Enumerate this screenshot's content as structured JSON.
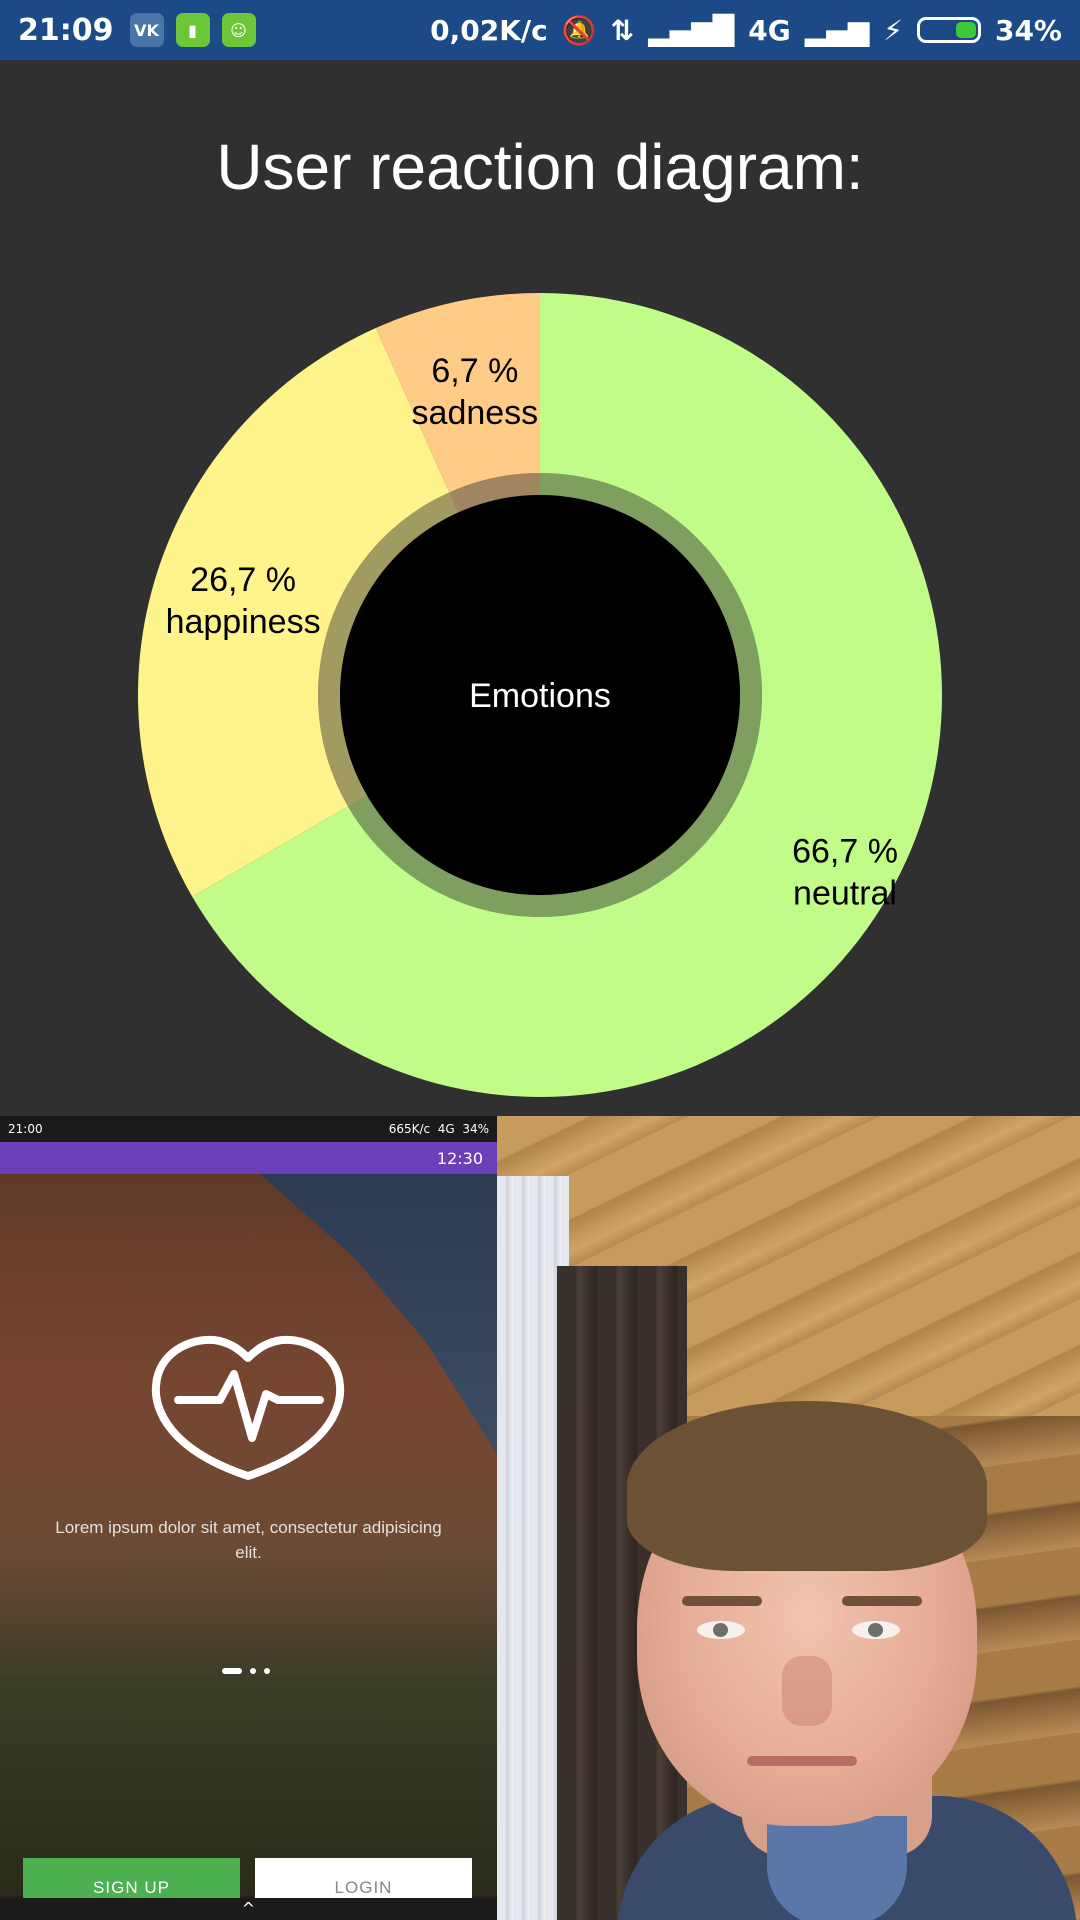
{
  "status_bar": {
    "time": "21:09",
    "speed": "0,02K/с",
    "network": "4G",
    "battery": "34%",
    "battery_level": 0.34,
    "app_icons": [
      "vk-icon",
      "battery-app-icon",
      "android-icon"
    ]
  },
  "chart_data": {
    "type": "pie",
    "title": "User reaction diagram:",
    "center_label": "Emotions",
    "slices": [
      {
        "value": 66.7,
        "percent_label": "66,7 %",
        "name": "neutral",
        "color": "#c1fc88"
      },
      {
        "value": 26.7,
        "percent_label": "26,7 %",
        "name": "happiness",
        "color": "#fff38b"
      },
      {
        "value": 6.7,
        "percent_label": "6,7 %",
        "name": "sadness",
        "color": "#ffcc88"
      }
    ]
  },
  "preview_app": {
    "status_time": "21:00",
    "status_speed": "665K/с",
    "status_network": "4G",
    "status_battery": "34%",
    "appbar_time": "12:30",
    "tagline": "Lorem ipsum dolor sit amet, consectetur adipisicing elit.",
    "signup_label": "SIGN UP",
    "login_label": "LOGIN",
    "nav_glyph": "^"
  },
  "colors": {
    "status_bar": "#1c4a86",
    "background": "#303030",
    "appbar": "#6a3fb8",
    "signup": "#4caf50"
  }
}
